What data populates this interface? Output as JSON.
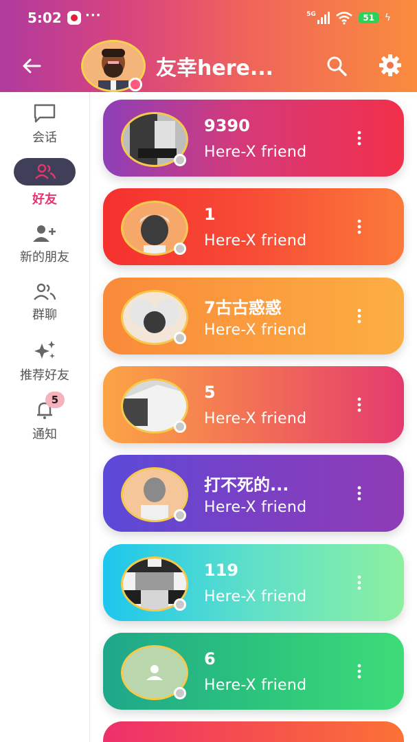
{
  "status_bar": {
    "time": "5:02",
    "dots": "···",
    "network": "5G",
    "battery": "51"
  },
  "header": {
    "title": "友幸here..."
  },
  "sidebar": {
    "items": [
      {
        "label": "会话"
      },
      {
        "label": "好友"
      },
      {
        "label": "新的朋友"
      },
      {
        "label": "群聊"
      },
      {
        "label": "推荐好友"
      },
      {
        "label": "通知",
        "badge": "5"
      }
    ]
  },
  "friends": [
    {
      "name": "9390",
      "subtitle": "Here-X friend"
    },
    {
      "name": "1",
      "subtitle": "Here-X friend"
    },
    {
      "name": "7古古惑惑",
      "subtitle": "Here-X friend"
    },
    {
      "name": "5",
      "subtitle": "Here-X friend"
    },
    {
      "name": "打不死的...",
      "subtitle": "Here-X friend"
    },
    {
      "name": "119",
      "subtitle": "Here-X friend"
    },
    {
      "name": "6",
      "subtitle": "Here-X friend"
    },
    {
      "name": "",
      "subtitle": ""
    }
  ],
  "colors": {
    "active_accent": "#e5356f",
    "card_gradients": [
      "purple-to-red",
      "red-to-orange",
      "orange-to-amber",
      "amber-to-pink",
      "violet-to-purple",
      "cyan-to-mint",
      "teal-to-green",
      "pink-to-orange"
    ]
  }
}
